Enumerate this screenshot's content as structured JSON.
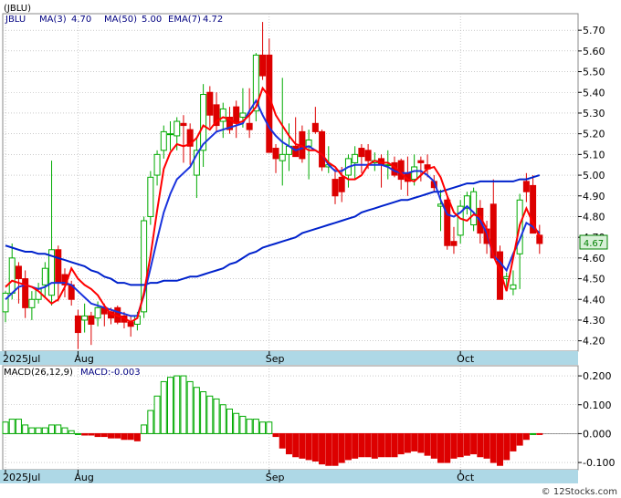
{
  "header": {
    "symbol": "(JBLU)",
    "ticker": "JBLU",
    "ma3_label": "MA(3)",
    "ma3_value": "4.70",
    "ma50_label": "MA(50)",
    "ma50_value": "5.00",
    "ema7_label": "EMA(7)",
    "ema7_value": "4.72"
  },
  "macd_header": {
    "params": "MACD(26,12,9)",
    "value": "MACD:-0.003"
  },
  "last_price_tag": "4.67",
  "watermark": "© 12Stocks.com",
  "colors": {
    "up": "#00aa00",
    "down": "#dd0000",
    "ma3": "#ff0000",
    "ma50": "#0022cc",
    "ema7": "#1a33dd",
    "strip": "#aed8e6",
    "grid": "#aaaaaa",
    "price_tag": "#008000"
  },
  "chart_data": [
    {
      "type": "candlestick",
      "ylim": [
        4.15,
        5.78
      ],
      "y_ticks": [
        "5.70",
        "5.60",
        "5.50",
        "5.40",
        "5.30",
        "5.20",
        "5.10",
        "5.00",
        "4.90",
        "4.80",
        "4.70",
        "4.60",
        "4.50",
        "4.40",
        "4.30",
        "4.20"
      ],
      "x_labels": [
        {
          "label": "2025Jul",
          "index": 0
        },
        {
          "label": "Aug",
          "index": 11
        },
        {
          "label": "Sep",
          "index": 40
        },
        {
          "label": "Oct",
          "index": 69
        }
      ],
      "candles": [
        [
          4.34,
          4.44,
          4.29,
          4.43
        ],
        [
          4.43,
          4.67,
          4.4,
          4.6
        ],
        [
          4.56,
          4.58,
          4.38,
          4.5
        ],
        [
          4.5,
          4.54,
          4.31,
          4.36
        ],
        [
          4.36,
          4.44,
          4.3,
          4.4
        ],
        [
          4.4,
          4.48,
          4.38,
          4.45
        ],
        [
          4.47,
          4.58,
          4.41,
          4.55
        ],
        [
          4.42,
          5.07,
          4.37,
          4.64
        ],
        [
          4.64,
          4.66,
          4.39,
          4.48
        ],
        [
          4.52,
          4.55,
          4.41,
          4.47
        ],
        [
          4.47,
          4.49,
          4.37,
          4.4
        ],
        [
          4.32,
          4.35,
          4.16,
          4.24
        ],
        [
          4.3,
          4.38,
          4.24,
          4.32
        ],
        [
          4.32,
          4.34,
          4.18,
          4.28
        ],
        [
          4.31,
          4.39,
          4.27,
          4.36
        ],
        [
          4.36,
          4.38,
          4.27,
          4.33
        ],
        [
          4.34,
          4.36,
          4.28,
          4.31
        ],
        [
          4.36,
          4.37,
          4.28,
          4.29
        ],
        [
          4.32,
          4.34,
          4.26,
          4.29
        ],
        [
          4.29,
          4.32,
          4.22,
          4.27
        ],
        [
          4.28,
          4.34,
          4.25,
          4.32
        ],
        [
          4.34,
          4.8,
          4.31,
          4.78
        ],
        [
          4.8,
          5.02,
          4.76,
          4.99
        ],
        [
          5.0,
          5.12,
          4.95,
          5.1
        ],
        [
          5.12,
          5.24,
          5.08,
          5.21
        ],
        [
          5.2,
          5.26,
          5.12,
          5.2
        ],
        [
          5.19,
          5.28,
          5.12,
          5.26
        ],
        [
          5.25,
          5.29,
          5.06,
          5.24
        ],
        [
          5.22,
          5.25,
          5.05,
          5.14
        ],
        [
          5.0,
          5.18,
          4.89,
          5.12
        ],
        [
          5.12,
          5.44,
          5.04,
          5.39
        ],
        [
          5.4,
          5.43,
          5.23,
          5.29
        ],
        [
          5.34,
          5.4,
          5.21,
          5.24
        ],
        [
          5.26,
          5.35,
          5.18,
          5.32
        ],
        [
          5.28,
          5.33,
          5.2,
          5.22
        ],
        [
          5.33,
          5.36,
          5.18,
          5.25
        ],
        [
          5.28,
          5.42,
          5.23,
          5.3
        ],
        [
          5.25,
          5.42,
          5.18,
          5.22
        ],
        [
          5.31,
          5.59,
          5.26,
          5.58
        ],
        [
          5.58,
          5.74,
          5.46,
          5.48
        ],
        [
          5.58,
          5.66,
          5.29,
          5.11
        ],
        [
          5.13,
          5.15,
          5.01,
          5.08
        ],
        [
          5.07,
          5.47,
          4.95,
          5.1
        ],
        [
          5.1,
          5.25,
          5.02,
          5.14
        ],
        [
          5.14,
          5.28,
          5.09,
          5.09
        ],
        [
          5.21,
          5.24,
          5.06,
          5.08
        ],
        [
          5.14,
          5.22,
          4.98,
          5.17
        ],
        [
          5.25,
          5.33,
          5.2,
          5.21
        ],
        [
          5.21,
          5.22,
          5.02,
          5.04
        ],
        [
          5.04,
          5.14,
          5.01,
          5.05
        ],
        [
          4.98,
          5.03,
          4.86,
          4.9
        ],
        [
          4.99,
          5.04,
          4.87,
          4.92
        ],
        [
          5.0,
          5.1,
          4.94,
          5.08
        ],
        [
          5.06,
          5.14,
          4.98,
          5.1
        ],
        [
          5.13,
          5.15,
          5.01,
          5.09
        ],
        [
          5.12,
          5.15,
          5.03,
          5.07
        ],
        [
          5.06,
          5.11,
          5.02,
          5.07
        ],
        [
          5.08,
          5.1,
          4.94,
          5.05
        ],
        [
          5.05,
          5.12,
          4.98,
          5.05
        ],
        [
          5.06,
          5.09,
          4.99,
          5.0
        ],
        [
          5.07,
          5.08,
          4.93,
          4.98
        ],
        [
          5.01,
          5.09,
          4.9,
          4.97
        ],
        [
          4.98,
          5.1,
          4.95,
          5.04
        ],
        [
          5.07,
          5.09,
          4.97,
          5.06
        ],
        [
          5.05,
          5.1,
          4.99,
          5.03
        ],
        [
          4.97,
          5.0,
          4.92,
          4.94
        ],
        [
          4.85,
          4.93,
          4.73,
          4.86
        ],
        [
          4.88,
          4.9,
          4.64,
          4.66
        ],
        [
          4.68,
          4.75,
          4.62,
          4.66
        ],
        [
          4.71,
          4.88,
          4.67,
          4.85
        ],
        [
          4.84,
          4.92,
          4.81,
          4.9
        ],
        [
          4.76,
          4.94,
          4.73,
          4.92
        ],
        [
          4.84,
          4.88,
          4.67,
          4.72
        ],
        [
          4.74,
          4.78,
          4.62,
          4.67
        ],
        [
          4.86,
          4.98,
          4.6,
          4.6
        ],
        [
          4.63,
          4.66,
          4.4,
          4.4
        ],
        [
          4.5,
          4.53,
          4.45,
          4.51
        ],
        [
          4.45,
          4.54,
          4.42,
          4.47
        ],
        [
          4.62,
          4.91,
          4.45,
          4.88
        ],
        [
          4.97,
          5.01,
          4.87,
          4.92
        ],
        [
          4.95,
          5.0,
          4.78,
          4.72
        ],
        [
          4.71,
          4.76,
          4.62,
          4.67
        ]
      ],
      "ma3": [
        4.46,
        4.49,
        4.48,
        4.47,
        4.46,
        4.44,
        4.41,
        4.38,
        4.4,
        4.46,
        4.55,
        4.5,
        4.47,
        4.45,
        4.42,
        4.37,
        4.33,
        4.32,
        4.31,
        4.29,
        4.31,
        4.43,
        4.61,
        4.83,
        5.03,
        5.11,
        5.15,
        5.14,
        5.15,
        5.18,
        5.24,
        5.22,
        5.26,
        5.28,
        5.27,
        5.25,
        5.26,
        5.29,
        5.33,
        5.42,
        5.38,
        5.29,
        5.24,
        5.19,
        5.15,
        5.14,
        5.12,
        5.12,
        5.1,
        5.06,
        5.04,
        5.0,
        4.98,
        4.98,
        5.0,
        5.05,
        5.07,
        5.06,
        5.06,
        5.04,
        5.01,
        4.98,
        4.97,
        5.0,
        5.03,
        5.04,
        4.99,
        4.9,
        4.82,
        4.79,
        4.78,
        4.81,
        4.8,
        4.74,
        4.61,
        4.54,
        4.44,
        4.6,
        4.76,
        4.84,
        4.77,
        4.7
      ],
      "ma50": [
        4.66,
        4.65,
        4.64,
        4.63,
        4.63,
        4.62,
        4.62,
        4.61,
        4.6,
        4.59,
        4.58,
        4.57,
        4.56,
        4.54,
        4.53,
        4.51,
        4.5,
        4.48,
        4.48,
        4.47,
        4.47,
        4.47,
        4.48,
        4.48,
        4.49,
        4.49,
        4.49,
        4.5,
        4.51,
        4.51,
        4.52,
        4.53,
        4.54,
        4.55,
        4.57,
        4.58,
        4.6,
        4.62,
        4.63,
        4.65,
        4.66,
        4.67,
        4.68,
        4.69,
        4.7,
        4.72,
        4.73,
        4.74,
        4.75,
        4.76,
        4.77,
        4.78,
        4.79,
        4.8,
        4.82,
        4.83,
        4.84,
        4.85,
        4.86,
        4.87,
        4.88,
        4.88,
        4.89,
        4.9,
        4.91,
        4.92,
        4.92,
        4.93,
        4.94,
        4.95,
        4.96,
        4.96,
        4.97,
        4.97,
        4.97,
        4.97,
        4.97,
        4.97,
        4.98,
        4.98,
        4.99,
        5.0
      ],
      "ema7": [
        4.4,
        4.43,
        4.46,
        4.47,
        4.46,
        4.45,
        4.46,
        4.48,
        4.48,
        4.48,
        4.47,
        4.44,
        4.41,
        4.38,
        4.37,
        4.36,
        4.35,
        4.34,
        4.33,
        4.32,
        4.32,
        4.42,
        4.55,
        4.69,
        4.82,
        4.91,
        4.98,
        5.01,
        5.04,
        5.1,
        5.15,
        5.18,
        5.21,
        5.22,
        5.23,
        5.24,
        5.25,
        5.31,
        5.36,
        5.29,
        5.23,
        5.19,
        5.16,
        5.14,
        5.12,
        5.13,
        5.14,
        5.12,
        5.1,
        5.05,
        5.02,
        5.02,
        5.04,
        5.05,
        5.05,
        5.05,
        5.05,
        5.05,
        5.04,
        5.02,
        5.01,
        5.01,
        5.02,
        5.02,
        5.0,
        4.97,
        4.88,
        4.81,
        4.8,
        4.82,
        4.85,
        4.82,
        4.78,
        4.72,
        4.61,
        4.58,
        4.54,
        4.62,
        4.69,
        4.77,
        4.75,
        4.72
      ]
    },
    {
      "type": "bar",
      "series": "MACD histogram",
      "ylim": [
        -0.125,
        0.235
      ],
      "y_ticks": [
        "0.200",
        "0.100",
        "0.000",
        "-0.100"
      ],
      "x_labels": [
        {
          "label": "2025Jul",
          "index": 0
        },
        {
          "label": "Aug",
          "index": 11
        },
        {
          "label": "Sep",
          "index": 40
        },
        {
          "label": "Oct",
          "index": 69
        }
      ],
      "values": [
        0.04,
        0.05,
        0.05,
        0.03,
        0.02,
        0.02,
        0.02,
        0.03,
        0.03,
        0.02,
        0.01,
        0.0,
        -0.005,
        -0.005,
        -0.01,
        -0.01,
        -0.015,
        -0.015,
        -0.02,
        -0.02,
        -0.025,
        0.03,
        0.08,
        0.13,
        0.18,
        0.195,
        0.2,
        0.2,
        0.18,
        0.16,
        0.145,
        0.13,
        0.12,
        0.1,
        0.085,
        0.07,
        0.06,
        0.05,
        0.05,
        0.04,
        0.04,
        -0.01,
        -0.05,
        -0.07,
        -0.08,
        -0.085,
        -0.09,
        -0.095,
        -0.105,
        -0.11,
        -0.11,
        -0.1,
        -0.09,
        -0.085,
        -0.08,
        -0.08,
        -0.085,
        -0.08,
        -0.08,
        -0.08,
        -0.07,
        -0.065,
        -0.06,
        -0.065,
        -0.075,
        -0.085,
        -0.1,
        -0.1,
        -0.085,
        -0.08,
        -0.075,
        -0.07,
        -0.08,
        -0.085,
        -0.1,
        -0.11,
        -0.09,
        -0.06,
        -0.04,
        -0.02,
        0.0,
        -0.003
      ]
    }
  ]
}
